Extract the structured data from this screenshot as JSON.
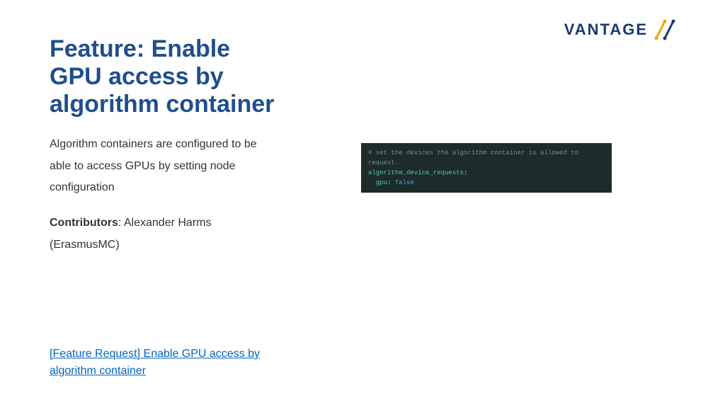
{
  "logo": {
    "text": "VANTAGE"
  },
  "title": "Feature: Enable GPU access by algorithm container",
  "description": "Algorithm containers are configured to be able to access GPUs by setting node configuration",
  "contributors": {
    "label": "Contributors",
    "text": ": Alexander Harms (ErasmusMC)"
  },
  "link": {
    "text": "[Feature Request] Enable GPU access by algorithm container"
  },
  "code": {
    "comment": "# set the devices the algorithm container is allowed to request.",
    "line1_key": "algorithm_device_requests",
    "line2_key": "gpu",
    "line2_value": "false"
  }
}
